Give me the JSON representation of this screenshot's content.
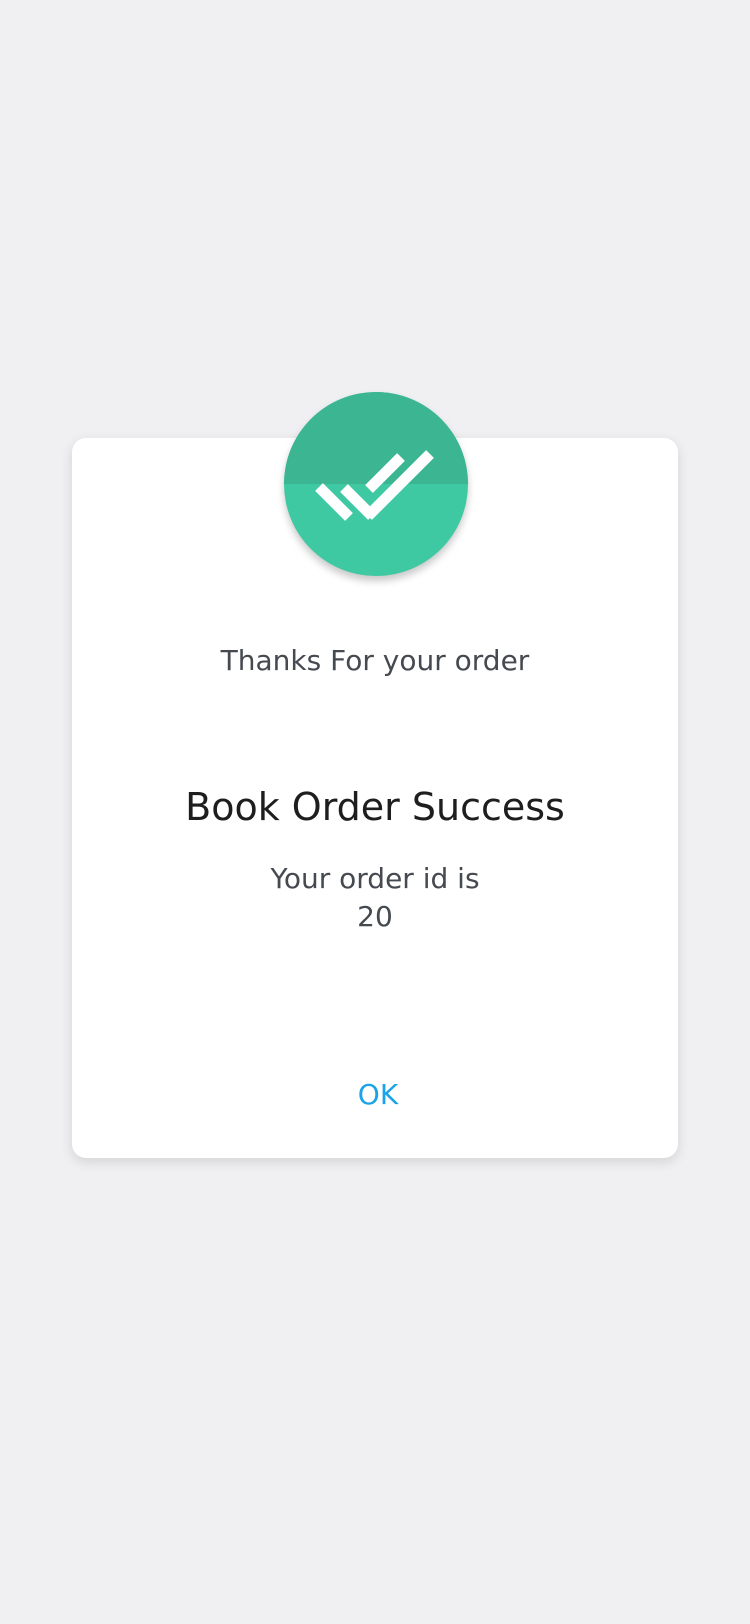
{
  "dialog": {
    "icon": "double-check-icon",
    "subtitle": "Thanks For your order",
    "title": "Book Order Success",
    "order_label": "Your order id is",
    "order_id": "20",
    "ok_label": "OK"
  },
  "colors": {
    "background": "#f0f0f2",
    "badge": "#3ec9a2",
    "badge_top": "#3cb592",
    "ok_button": "#1aa3e8"
  }
}
